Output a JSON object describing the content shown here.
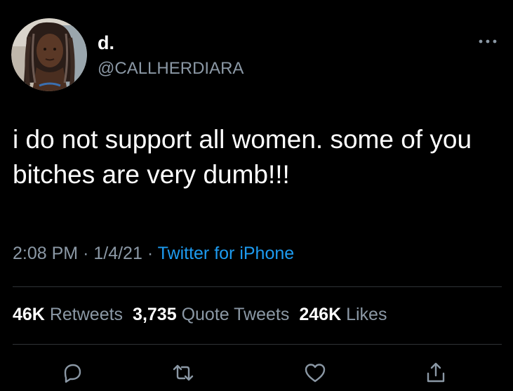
{
  "author": {
    "display_name": "d.",
    "handle": "@CALLHERDIARA",
    "avatar_icon": "profile-photo"
  },
  "more_icon": "ellipsis-icon",
  "tweet": {
    "text": "i do not support all women. some of you bitches are very dumb!!!",
    "time": "2:08 PM",
    "separator": "·",
    "date": "1/4/21",
    "source": "Twitter for iPhone"
  },
  "stats": {
    "retweets_count": "46K",
    "retweets_label": "Retweets",
    "quote_count": "3,735",
    "quote_label": "Quote Tweets",
    "likes_count": "246K",
    "likes_label": "Likes"
  },
  "actions": {
    "reply_icon": "reply-icon",
    "retweet_icon": "retweet-icon",
    "like_icon": "heart-icon",
    "share_icon": "share-icon"
  },
  "colors": {
    "background": "#000000",
    "primary_text": "#ffffff",
    "secondary_text": "#8b98a5",
    "accent": "#1d9bf0",
    "divider": "#2f3336"
  }
}
